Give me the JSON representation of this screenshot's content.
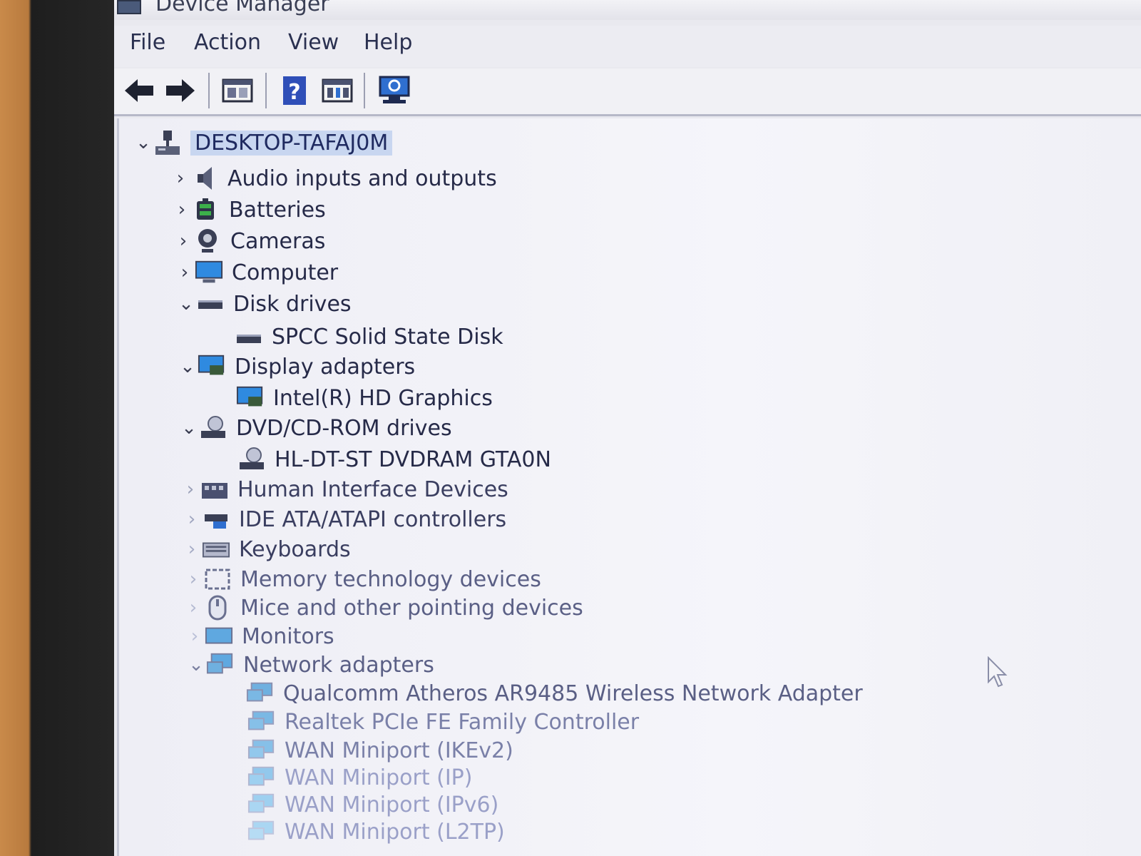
{
  "window": {
    "title": "Device Manager"
  },
  "menu": {
    "items": [
      "File",
      "Action",
      "View",
      "Help"
    ]
  },
  "toolbar": {
    "buttons": [
      "back-icon",
      "forward-icon",
      "properties-icon",
      "help-icon",
      "update-driver-icon",
      "scan-hardware-icon"
    ]
  },
  "colors": {
    "selection": "#c8d6f0",
    "window_bg": "#f4f4f9",
    "text": "#262a48",
    "accent_blue": "#2f6fd0"
  },
  "tree": {
    "root": {
      "label": "DESKTOP-TAFAJ0M",
      "expanded": true
    },
    "items": [
      {
        "label": "Audio inputs and outputs",
        "icon": "speaker-icon",
        "expanded": false
      },
      {
        "label": "Batteries",
        "icon": "battery-icon",
        "expanded": false
      },
      {
        "label": "Cameras",
        "icon": "camera-icon",
        "expanded": false
      },
      {
        "label": "Computer",
        "icon": "computer-icon",
        "expanded": false
      },
      {
        "label": "Disk drives",
        "icon": "disk-drive-icon",
        "expanded": true,
        "children": [
          "SPCC Solid State Disk"
        ]
      },
      {
        "label": "Display adapters",
        "icon": "display-adapter-icon",
        "expanded": true,
        "children": [
          "Intel(R) HD Graphics"
        ]
      },
      {
        "label": "DVD/CD-ROM drives",
        "icon": "dvd-drive-icon",
        "expanded": true,
        "children": [
          "HL-DT-ST DVDRAM GTA0N"
        ]
      },
      {
        "label": "Human Interface Devices",
        "icon": "hid-icon",
        "expanded": false
      },
      {
        "label": "IDE ATA/ATAPI controllers",
        "icon": "ide-controller-icon",
        "expanded": false
      },
      {
        "label": "Keyboards",
        "icon": "keyboard-icon",
        "expanded": false
      },
      {
        "label": "Memory technology devices",
        "icon": "memory-icon",
        "expanded": false
      },
      {
        "label": "Mice and other pointing devices",
        "icon": "mouse-icon",
        "expanded": false
      },
      {
        "label": "Monitors",
        "icon": "monitor-icon",
        "expanded": false
      },
      {
        "label": "Network adapters",
        "icon": "network-adapter-icon",
        "expanded": true,
        "children": [
          "Qualcomm Atheros AR9485 Wireless Network Adapter",
          "Realtek PCIe FE Family Controller",
          "WAN Miniport (IKEv2)",
          "WAN Miniport (IP)",
          "WAN Miniport (IPv6)",
          "WAN Miniport (L2TP)"
        ]
      }
    ]
  }
}
